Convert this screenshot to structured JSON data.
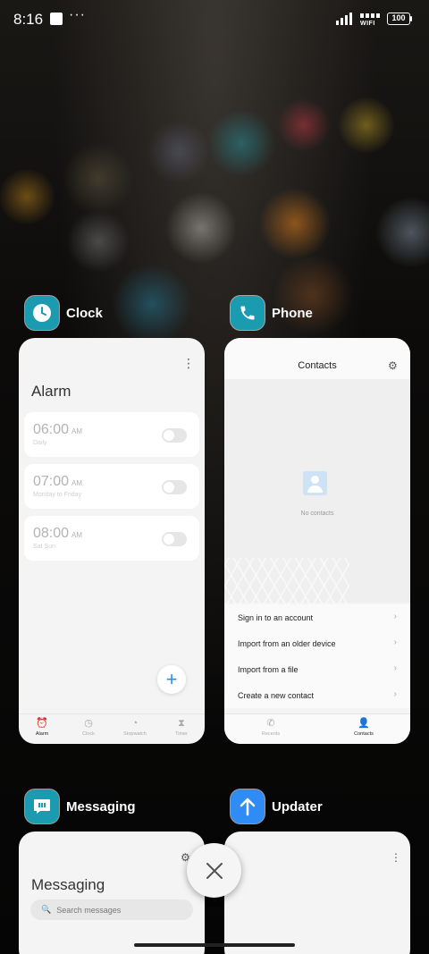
{
  "status_bar": {
    "time": "8:16",
    "more": "···",
    "wifi_label": "WIFI",
    "battery": "100"
  },
  "apps": {
    "clock": {
      "name": "Clock",
      "icon_color": "#1a9bb0",
      "screen": {
        "title": "Alarm",
        "alarms": [
          {
            "time": "06:00",
            "ampm": "AM",
            "repeat": "Daily",
            "enabled": false
          },
          {
            "time": "07:00",
            "ampm": "AM",
            "repeat": "Monday to Friday",
            "enabled": false
          },
          {
            "time": "08:00",
            "ampm": "AM",
            "repeat": "Sat Sun",
            "enabled": false
          }
        ],
        "add_button": "+",
        "tabs": [
          {
            "label": "Alarm",
            "icon": "alarm-icon",
            "active": true
          },
          {
            "label": "Clock",
            "icon": "clock-icon",
            "active": false
          },
          {
            "label": "Stopwatch",
            "icon": "stopwatch-icon",
            "active": false
          },
          {
            "label": "Timer",
            "icon": "hourglass-icon",
            "active": false
          }
        ]
      }
    },
    "phone": {
      "name": "Phone",
      "icon_color": "#1a9bb0",
      "screen": {
        "title": "Contacts",
        "empty_text": "No contacts",
        "actions": [
          "Sign in to an account",
          "Import from an older device",
          "Import from a file",
          "Create a new contact"
        ],
        "tabs": [
          {
            "label": "Recents",
            "icon": "phone-icon",
            "active": false
          },
          {
            "label": "Contacts",
            "icon": "person-icon",
            "active": true
          }
        ]
      }
    },
    "messaging": {
      "name": "Messaging",
      "icon_color": "#1a9bb0",
      "screen": {
        "title": "Messaging",
        "search_placeholder": "Search messages"
      }
    },
    "updater": {
      "name": "Updater",
      "icon_color": "#2f8cf5"
    }
  }
}
